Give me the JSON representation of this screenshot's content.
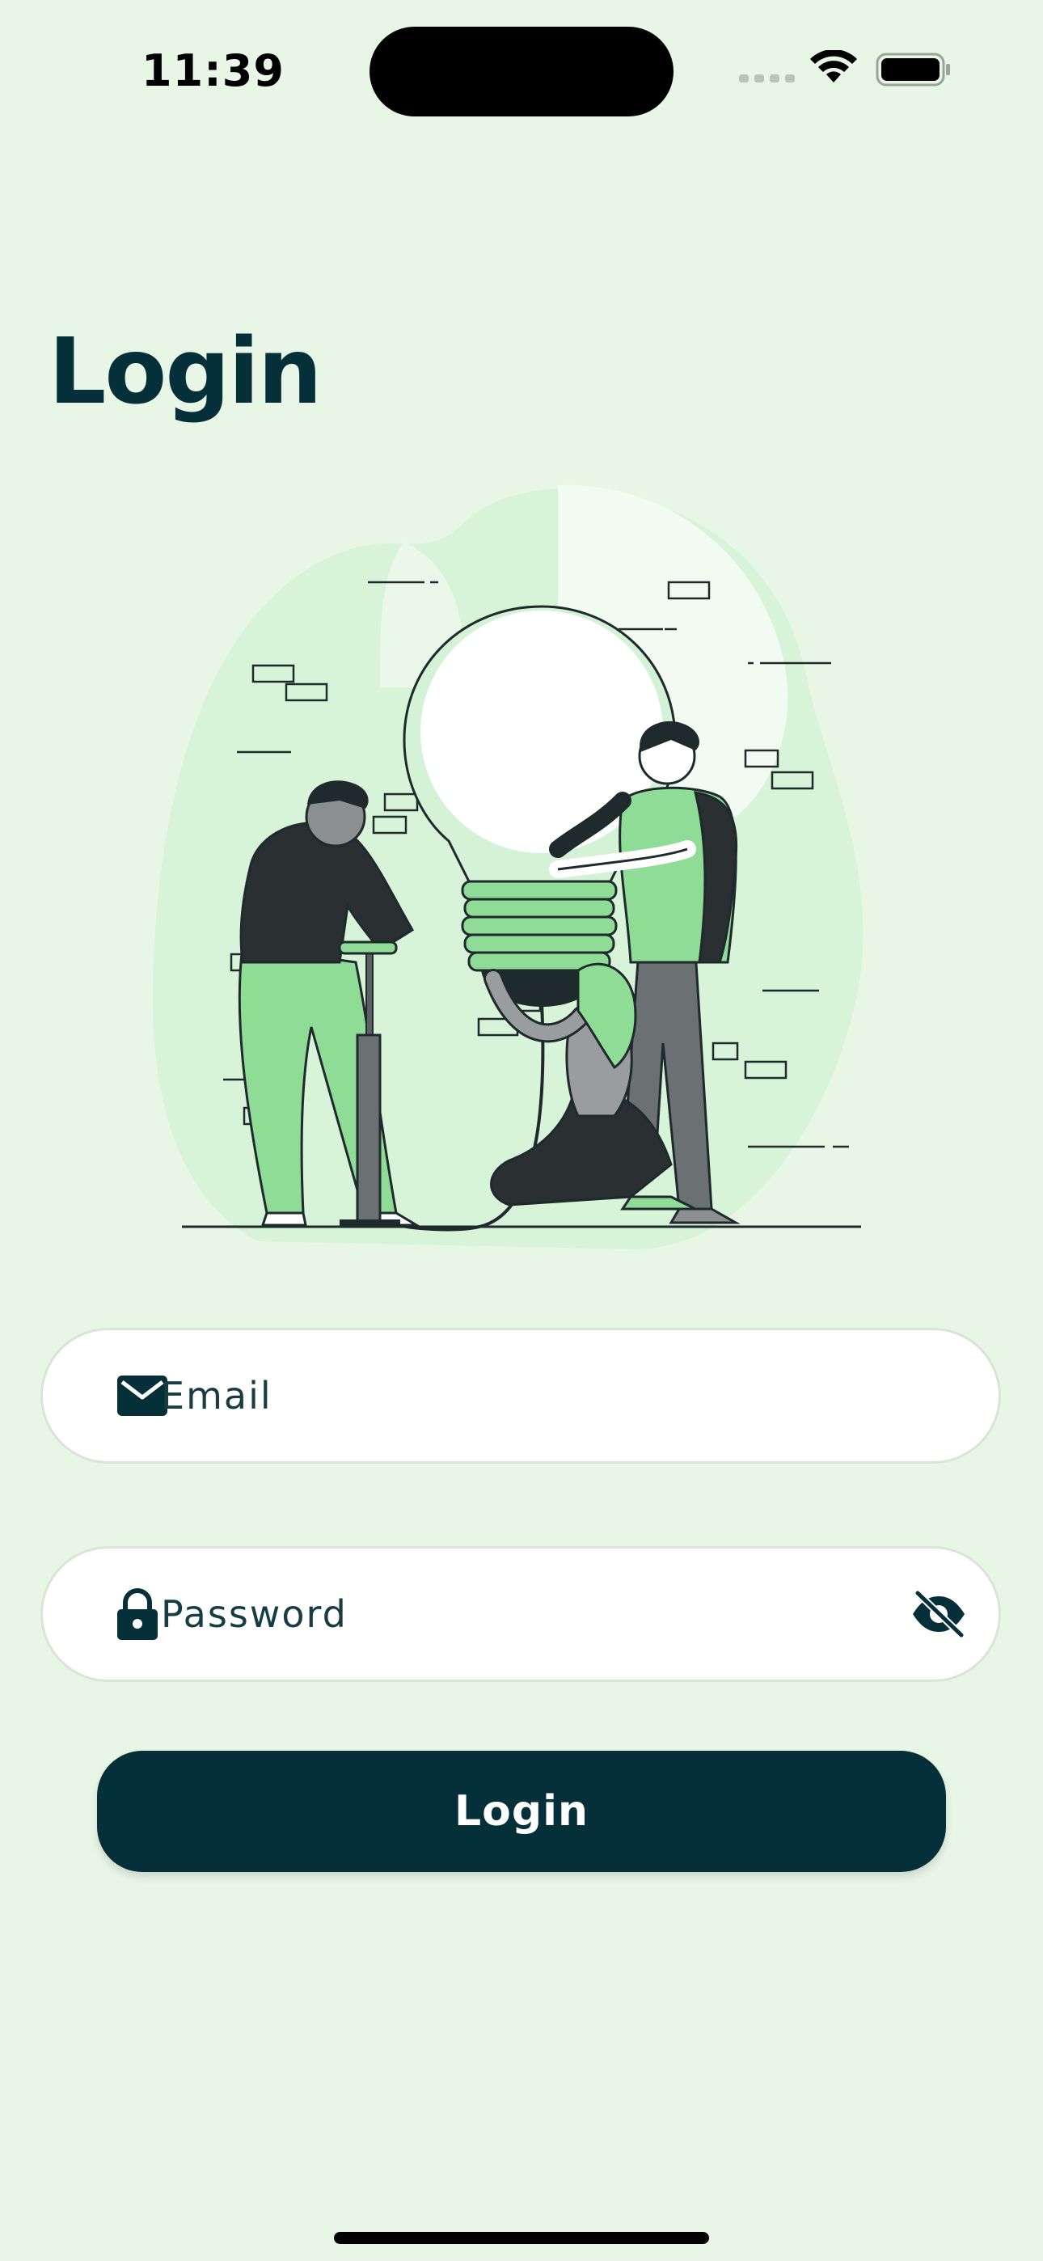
{
  "status_bar": {
    "time": "11:39"
  },
  "page": {
    "title": "Login"
  },
  "form": {
    "email": {
      "placeholder": "Email",
      "value": "",
      "icon": "envelope-icon"
    },
    "password": {
      "placeholder": "Password",
      "value": "",
      "icon": "lock-icon",
      "toggle_icon": "eye-slash-icon"
    },
    "submit_label": "Login"
  },
  "colors": {
    "background": "#e8f6e6",
    "primary": "#05303a",
    "accent_green": "#8fdc97",
    "field_bg": "#ffffff"
  }
}
